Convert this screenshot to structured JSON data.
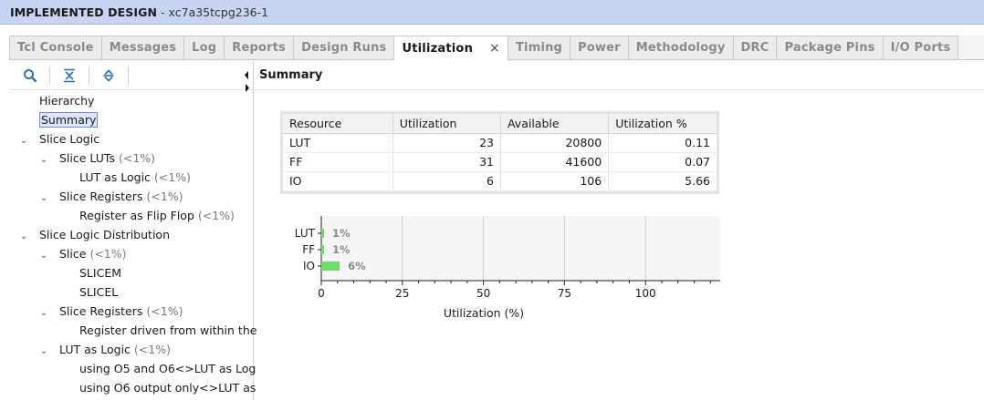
{
  "header": {
    "title": "IMPLEMENTED DESIGN",
    "part": "- xc7a35tcpg236-1"
  },
  "tabs": [
    {
      "label": "Tcl Console",
      "active": false
    },
    {
      "label": "Messages",
      "active": false
    },
    {
      "label": "Log",
      "active": false
    },
    {
      "label": "Reports",
      "active": false
    },
    {
      "label": "Design Runs",
      "active": false
    },
    {
      "label": "Utilization",
      "active": true
    },
    {
      "label": "Timing",
      "active": false
    },
    {
      "label": "Power",
      "active": false
    },
    {
      "label": "Methodology",
      "active": false
    },
    {
      "label": "DRC",
      "active": false
    },
    {
      "label": "Package Pins",
      "active": false
    },
    {
      "label": "I/O Ports",
      "active": false
    }
  ],
  "toolbar": {
    "icons": [
      "search-icon",
      "collapse-all-icon",
      "expand-all-icon"
    ]
  },
  "tree": [
    {
      "label": "Hierarchy",
      "pct": "",
      "level": 0,
      "toggle": ""
    },
    {
      "label": "Summary",
      "pct": "",
      "level": 0,
      "toggle": "",
      "selected": true
    },
    {
      "label": "Slice Logic",
      "pct": "",
      "level": 0,
      "toggle": "v"
    },
    {
      "label": "Slice LUTs",
      "pct": "(<1%)",
      "level": 1,
      "toggle": "v"
    },
    {
      "label": "LUT as Logic",
      "pct": "(<1%)",
      "level": 2,
      "toggle": ""
    },
    {
      "label": "Slice Registers",
      "pct": "(<1%)",
      "level": 1,
      "toggle": "v"
    },
    {
      "label": "Register as Flip Flop",
      "pct": "(<1%)",
      "level": 2,
      "toggle": ""
    },
    {
      "label": "Slice Logic Distribution",
      "pct": "",
      "level": 0,
      "toggle": "v"
    },
    {
      "label": "Slice",
      "pct": "(<1%)",
      "level": 1,
      "toggle": "v"
    },
    {
      "label": "SLICEM",
      "pct": "",
      "level": 2,
      "toggle": ""
    },
    {
      "label": "SLICEL",
      "pct": "",
      "level": 2,
      "toggle": ""
    },
    {
      "label": "Slice Registers",
      "pct": "(<1%)",
      "level": 1,
      "toggle": "v"
    },
    {
      "label": "Register driven from within the",
      "pct": "",
      "level": 2,
      "toggle": ""
    },
    {
      "label": "LUT as Logic",
      "pct": "(<1%)",
      "level": 1,
      "toggle": "v"
    },
    {
      "label": "using O5 and O6<>LUT as Log",
      "pct": "",
      "level": 2,
      "toggle": ""
    },
    {
      "label": "using O6 output only<>LUT as",
      "pct": "",
      "level": 2,
      "toggle": ""
    }
  ],
  "summary": {
    "title": "Summary",
    "columns": [
      "Resource",
      "Utilization",
      "Available",
      "Utilization %"
    ],
    "rows": [
      [
        "LUT",
        "23",
        "20800",
        "0.11"
      ],
      [
        "FF",
        "31",
        "41600",
        "0.07"
      ],
      [
        "IO",
        "6",
        "106",
        "5.66"
      ]
    ]
  },
  "chart_data": {
    "type": "bar",
    "orientation": "horizontal",
    "categories": [
      "LUT",
      "FF",
      "IO"
    ],
    "values": [
      0.11,
      0.07,
      5.66
    ],
    "data_labels": [
      "1%",
      "1%",
      "6%"
    ],
    "xlabel": "Utilization (%)",
    "xlim": [
      0,
      125
    ],
    "xticks": [
      0,
      25,
      50,
      75,
      100
    ],
    "grid": true,
    "colors": {
      "bar": "#6ee06a",
      "plot_bg": "#f5f5f5",
      "grid": "#cfcfcf"
    }
  }
}
